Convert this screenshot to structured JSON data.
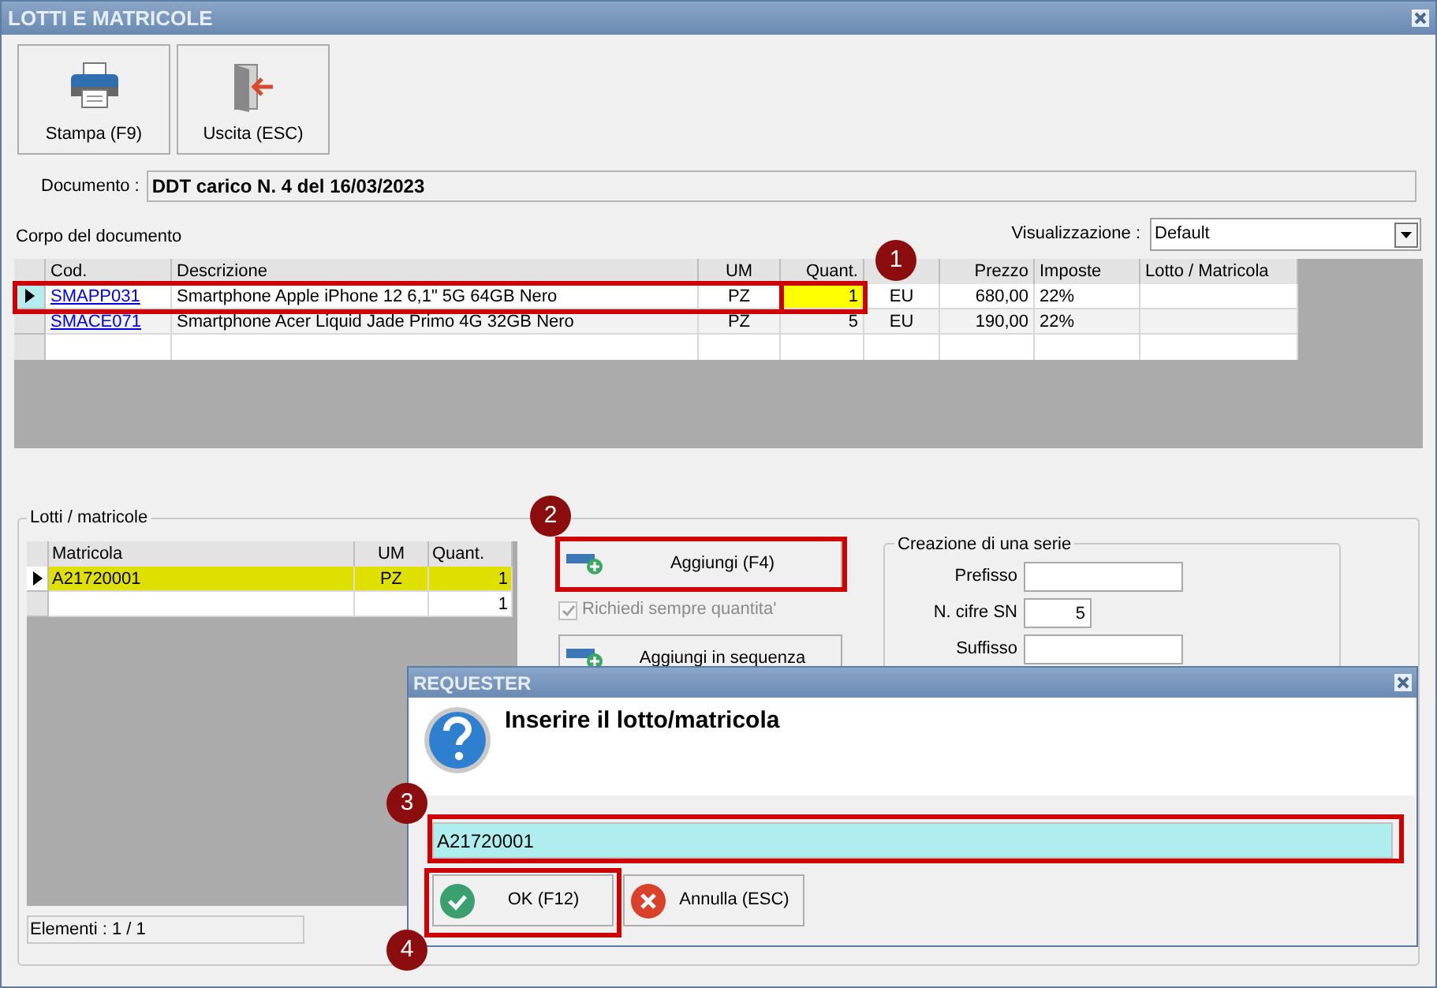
{
  "window": {
    "title": "LOTTI E MATRICOLE"
  },
  "toolbar": [
    {
      "kind": "print",
      "label": "Stampa (F9)"
    },
    {
      "kind": "exit",
      "label": "Uscita (ESC)"
    }
  ],
  "document": {
    "label": "Documento :",
    "value": "DDT carico N. 4 del 16/03/2023"
  },
  "body": {
    "title": "Corpo del documento",
    "view_label": "Visualizzazione :",
    "view_value": "Default",
    "columns": [
      {
        "label": "Cod."
      },
      {
        "label": "Descrizione"
      },
      {
        "label": "UM"
      },
      {
        "label": "Quant."
      },
      {},
      {
        "label": "Prezzo"
      },
      {
        "label": "Imposte"
      },
      {
        "label": "Lotto / Matricola"
      }
    ],
    "rows": [
      {
        "selected": true,
        "quant_highlighted": true,
        "cells": [
          "SMAPP031",
          "Smartphone Apple iPhone 12 6,1\" 5G 64GB Nero",
          "PZ",
          "1",
          "EU",
          "680,00",
          "22%"
        ]
      },
      {
        "selected": false,
        "quant_highlighted": false,
        "cells": [
          "SMACE071",
          "Smartphone Acer Liquid Jade Primo 4G 32GB Nero",
          "PZ",
          "5",
          "EU",
          "190,00",
          "22%"
        ]
      }
    ]
  },
  "lots": {
    "title": "Lotti / matricole",
    "columns": [
      "Matricola",
      "UM",
      "Quant."
    ],
    "rows": [
      {
        "selected": true,
        "matricola": "A21720001",
        "um": "PZ",
        "quant": "1"
      },
      {
        "selected": false,
        "quant": "1"
      }
    ],
    "counter": "Elementi : 1 / 1",
    "add_button": "Aggiungi (F4)",
    "always_ask": {
      "label": "Richiedi sempre quantita'",
      "checked": true,
      "disabled": true
    },
    "add_sequence_button": "Aggiungi in sequenza"
  },
  "series": {
    "title": "Creazione di una serie",
    "fields": [
      {
        "label": "Prefisso"
      },
      {
        "label": "N. cifre SN",
        "value": "5"
      },
      {
        "label": "Suffisso"
      }
    ]
  },
  "dialog": {
    "title": "REQUESTER",
    "message": "Inserire il lotto/matricola",
    "value": "A21720001",
    "buttons": [
      {
        "kind": "ok",
        "label": "OK (F12)"
      },
      {
        "kind": "cancel",
        "label": "Annulla (ESC)"
      }
    ]
  },
  "callouts": [
    "1",
    "2",
    "3",
    "4"
  ]
}
